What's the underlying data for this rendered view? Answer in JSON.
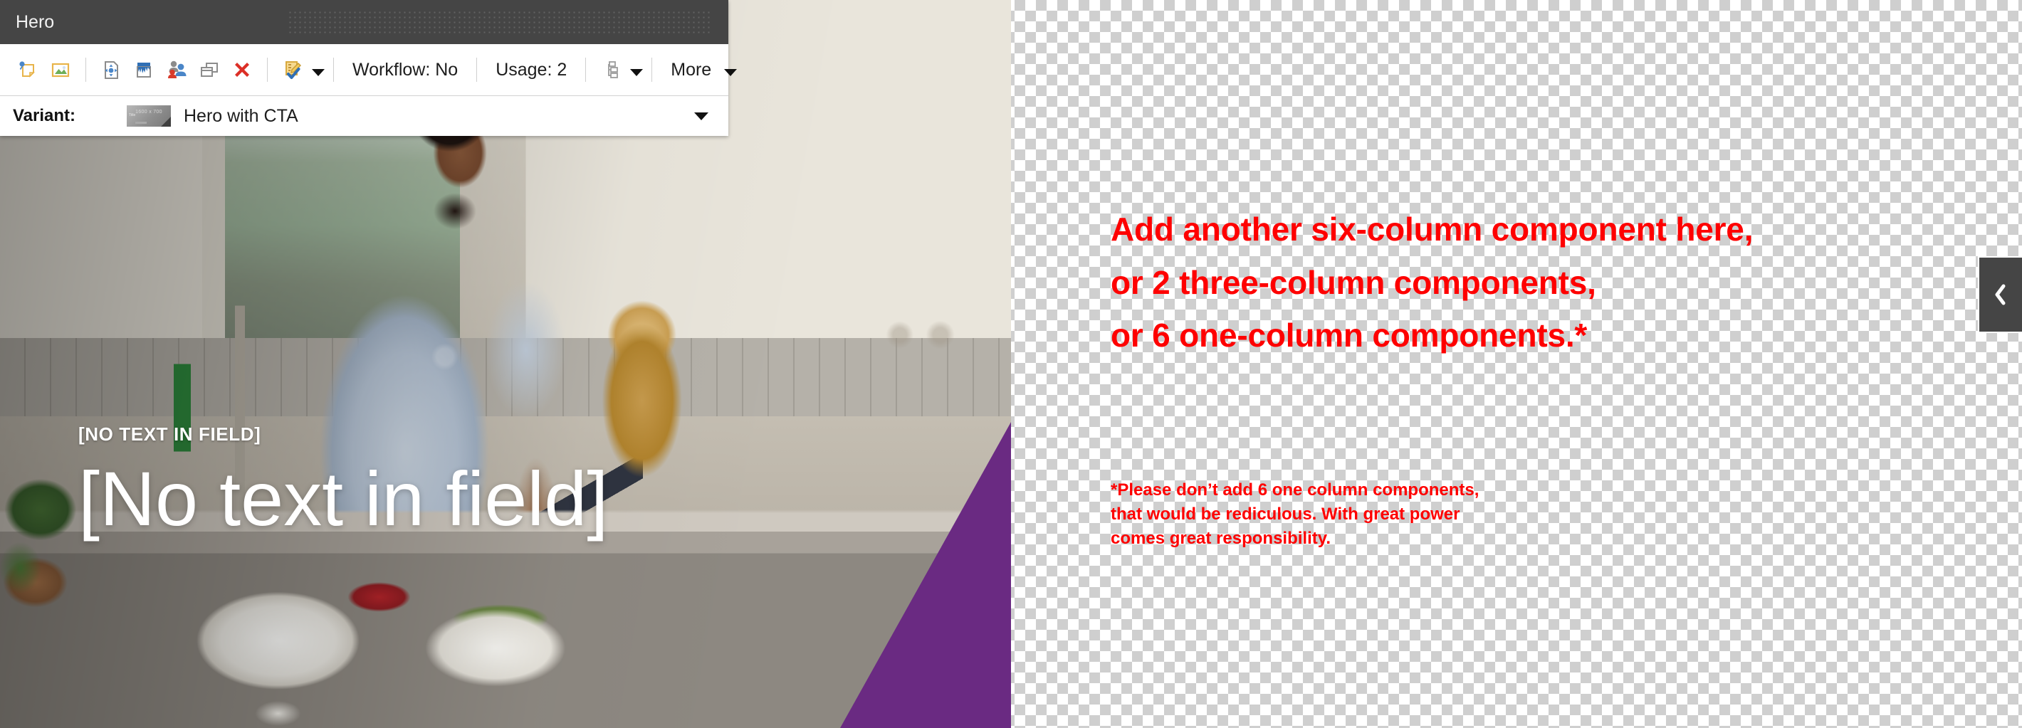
{
  "panel": {
    "title": "Hero",
    "toolbar": {
      "icons": [
        {
          "name": "insert-component-icon",
          "label": "Insert component"
        },
        {
          "name": "edit-image-icon",
          "label": "Edit image"
        },
        {
          "name": "move-page-icon",
          "label": "Move"
        },
        {
          "name": "paint-bucket-icon",
          "label": "Paint formatting"
        },
        {
          "name": "permissions-users-icon",
          "label": "Permissions"
        },
        {
          "name": "copy-windows-icon",
          "label": "Copy"
        },
        {
          "name": "delete-red-x-icon",
          "label": "Delete"
        },
        {
          "name": "workflow-approve-icon",
          "label": "Workflow actions"
        },
        {
          "name": "site-tree-icon",
          "label": "Site tree"
        }
      ],
      "workflow_label": "Workflow: No",
      "usage_label": "Usage: 2",
      "more_label": "More"
    },
    "variant": {
      "label": "Variant:",
      "thumb_dimensions": "1600 x 700",
      "thumb_tag": "Title",
      "value": "Hero with CTA"
    }
  },
  "hero": {
    "eyebrow": "[NO TEXT IN FIELD]",
    "headline": "[No text in field]",
    "accent_color": "#6a2a82"
  },
  "notes": {
    "headline": "Add another six-column component here,\nor 2 three-column components,\nor 6 one-column components.*",
    "footnote": "*Please don’t add 6 one column components,\nthat would be rediculous. With great power\ncomes great responsibility.",
    "color": "#fe0000"
  },
  "side_panel": {
    "collapse_icon": "chevron-left-icon"
  }
}
